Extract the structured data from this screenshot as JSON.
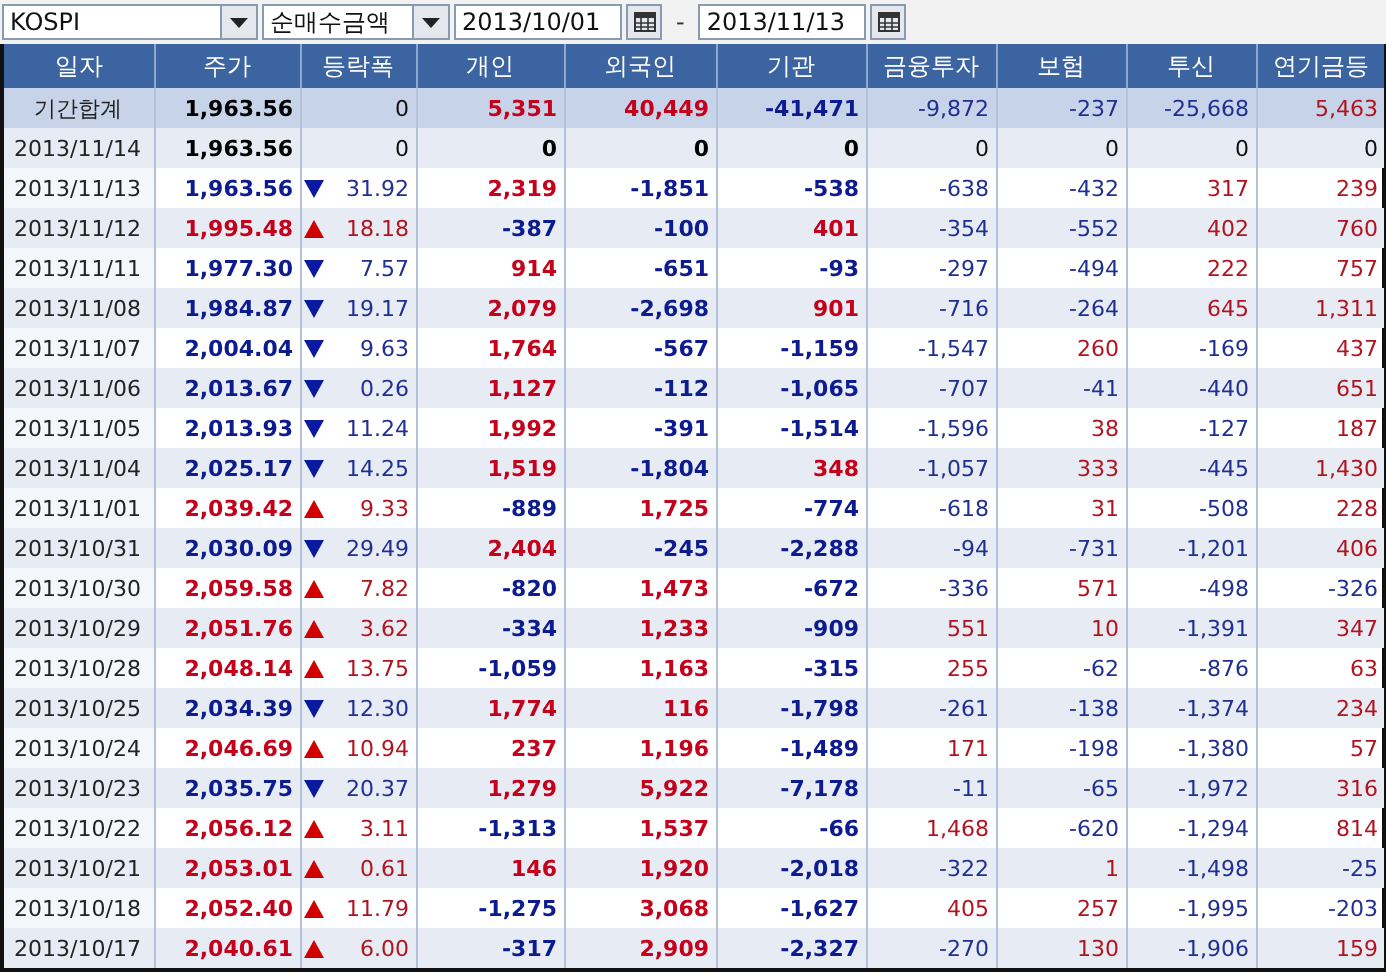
{
  "toolbar": {
    "market": {
      "value": "KOSPI"
    },
    "measure": {
      "value": "순매수금액"
    },
    "date_from": {
      "value": "2013/10/01"
    },
    "separator": "-",
    "date_to": {
      "value": "2013/11/13"
    }
  },
  "table": {
    "columns": [
      "일자",
      "주가",
      "등락폭",
      "개인",
      "외국인",
      "기관",
      "금융투자",
      "보험",
      "투신",
      "연기금등"
    ],
    "rows": [
      {
        "kind": "total",
        "date": "기간합계",
        "price": "1,963.56",
        "up": false,
        "down": false,
        "change": "0",
        "individual": "5,351",
        "foreign": "40,449",
        "institution": "-41,471",
        "financial_investment": "-9,872",
        "insurance": "-237",
        "trust": "-25,668",
        "pension": "5,463"
      },
      {
        "kind": "day",
        "date": "2013/11/14",
        "price": "1,963.56",
        "up": false,
        "down": false,
        "change": "0",
        "individual": "0",
        "foreign": "0",
        "institution": "0",
        "financial_investment": "0",
        "insurance": "0",
        "trust": "0",
        "pension": "0"
      },
      {
        "kind": "day",
        "date": "2013/11/13",
        "price": "1,963.56",
        "up": false,
        "down": true,
        "change": "31.92",
        "individual": "2,319",
        "foreign": "-1,851",
        "institution": "-538",
        "financial_investment": "-638",
        "insurance": "-432",
        "trust": "317",
        "pension": "239"
      },
      {
        "kind": "day",
        "date": "2013/11/12",
        "price": "1,995.48",
        "up": true,
        "down": false,
        "change": "18.18",
        "individual": "-387",
        "foreign": "-100",
        "institution": "401",
        "financial_investment": "-354",
        "insurance": "-552",
        "trust": "402",
        "pension": "760"
      },
      {
        "kind": "day",
        "date": "2013/11/11",
        "price": "1,977.30",
        "up": false,
        "down": true,
        "change": "7.57",
        "individual": "914",
        "foreign": "-651",
        "institution": "-93",
        "financial_investment": "-297",
        "insurance": "-494",
        "trust": "222",
        "pension": "757"
      },
      {
        "kind": "day",
        "date": "2013/11/08",
        "price": "1,984.87",
        "up": false,
        "down": true,
        "change": "19.17",
        "individual": "2,079",
        "foreign": "-2,698",
        "institution": "901",
        "financial_investment": "-716",
        "insurance": "-264",
        "trust": "645",
        "pension": "1,311"
      },
      {
        "kind": "day",
        "date": "2013/11/07",
        "price": "2,004.04",
        "up": false,
        "down": true,
        "change": "9.63",
        "individual": "1,764",
        "foreign": "-567",
        "institution": "-1,159",
        "financial_investment": "-1,547",
        "insurance": "260",
        "trust": "-169",
        "pension": "437"
      },
      {
        "kind": "day",
        "date": "2013/11/06",
        "price": "2,013.67",
        "up": false,
        "down": true,
        "change": "0.26",
        "individual": "1,127",
        "foreign": "-112",
        "institution": "-1,065",
        "financial_investment": "-707",
        "insurance": "-41",
        "trust": "-440",
        "pension": "651"
      },
      {
        "kind": "day",
        "date": "2013/11/05",
        "price": "2,013.93",
        "up": false,
        "down": true,
        "change": "11.24",
        "individual": "1,992",
        "foreign": "-391",
        "institution": "-1,514",
        "financial_investment": "-1,596",
        "insurance": "38",
        "trust": "-127",
        "pension": "187"
      },
      {
        "kind": "day",
        "date": "2013/11/04",
        "price": "2,025.17",
        "up": false,
        "down": true,
        "change": "14.25",
        "individual": "1,519",
        "foreign": "-1,804",
        "institution": "348",
        "financial_investment": "-1,057",
        "insurance": "333",
        "trust": "-445",
        "pension": "1,430"
      },
      {
        "kind": "day",
        "date": "2013/11/01",
        "price": "2,039.42",
        "up": true,
        "down": false,
        "change": "9.33",
        "individual": "-889",
        "foreign": "1,725",
        "institution": "-774",
        "financial_investment": "-618",
        "insurance": "31",
        "trust": "-508",
        "pension": "228"
      },
      {
        "kind": "day",
        "date": "2013/10/31",
        "price": "2,030.09",
        "up": false,
        "down": true,
        "change": "29.49",
        "individual": "2,404",
        "foreign": "-245",
        "institution": "-2,288",
        "financial_investment": "-94",
        "insurance": "-731",
        "trust": "-1,201",
        "pension": "406"
      },
      {
        "kind": "day",
        "date": "2013/10/30",
        "price": "2,059.58",
        "up": true,
        "down": false,
        "change": "7.82",
        "individual": "-820",
        "foreign": "1,473",
        "institution": "-672",
        "financial_investment": "-336",
        "insurance": "571",
        "trust": "-498",
        "pension": "-326"
      },
      {
        "kind": "day",
        "date": "2013/10/29",
        "price": "2,051.76",
        "up": true,
        "down": false,
        "change": "3.62",
        "individual": "-334",
        "foreign": "1,233",
        "institution": "-909",
        "financial_investment": "551",
        "insurance": "10",
        "trust": "-1,391",
        "pension": "347"
      },
      {
        "kind": "day",
        "date": "2013/10/28",
        "price": "2,048.14",
        "up": true,
        "down": false,
        "change": "13.75",
        "individual": "-1,059",
        "foreign": "1,163",
        "institution": "-315",
        "financial_investment": "255",
        "insurance": "-62",
        "trust": "-876",
        "pension": "63"
      },
      {
        "kind": "day",
        "date": "2013/10/25",
        "price": "2,034.39",
        "up": false,
        "down": true,
        "change": "12.30",
        "individual": "1,774",
        "foreign": "116",
        "institution": "-1,798",
        "financial_investment": "-261",
        "insurance": "-138",
        "trust": "-1,374",
        "pension": "234"
      },
      {
        "kind": "day",
        "date": "2013/10/24",
        "price": "2,046.69",
        "up": true,
        "down": false,
        "change": "10.94",
        "individual": "237",
        "foreign": "1,196",
        "institution": "-1,489",
        "financial_investment": "171",
        "insurance": "-198",
        "trust": "-1,380",
        "pension": "57"
      },
      {
        "kind": "day",
        "date": "2013/10/23",
        "price": "2,035.75",
        "up": false,
        "down": true,
        "change": "20.37",
        "individual": "1,279",
        "foreign": "5,922",
        "institution": "-7,178",
        "financial_investment": "-11",
        "insurance": "-65",
        "trust": "-1,972",
        "pension": "316"
      },
      {
        "kind": "day",
        "date": "2013/10/22",
        "price": "2,056.12",
        "up": true,
        "down": false,
        "change": "3.11",
        "individual": "-1,313",
        "foreign": "1,537",
        "institution": "-66",
        "financial_investment": "1,468",
        "insurance": "-620",
        "trust": "-1,294",
        "pension": "814"
      },
      {
        "kind": "day",
        "date": "2013/10/21",
        "price": "2,053.01",
        "up": true,
        "down": false,
        "change": "0.61",
        "individual": "146",
        "foreign": "1,920",
        "institution": "-2,018",
        "financial_investment": "-322",
        "insurance": "1",
        "trust": "-1,498",
        "pension": "-25"
      },
      {
        "kind": "day",
        "date": "2013/10/18",
        "price": "2,052.40",
        "up": true,
        "down": false,
        "change": "11.79",
        "individual": "-1,275",
        "foreign": "3,068",
        "institution": "-1,627",
        "financial_investment": "405",
        "insurance": "257",
        "trust": "-1,995",
        "pension": "-203"
      },
      {
        "kind": "day",
        "date": "2013/10/17",
        "price": "2,040.61",
        "up": true,
        "down": false,
        "change": "6.00",
        "individual": "-317",
        "foreign": "2,909",
        "institution": "-2,327",
        "financial_investment": "-270",
        "insurance": "130",
        "trust": "-1,906",
        "pension": "159"
      }
    ]
  }
}
